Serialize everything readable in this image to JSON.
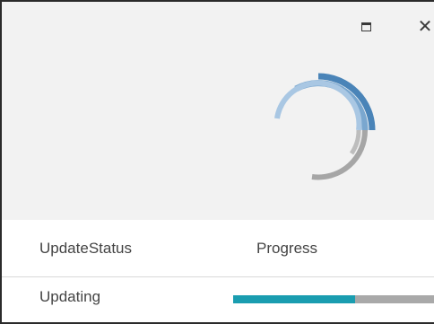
{
  "window": {
    "maximize_icon": "maximize-icon",
    "close_icon": "close-icon",
    "close_glyph": "✕"
  },
  "spinner": {
    "icon": "loading-spinner-icon",
    "colors": {
      "dark_blue": "#4a84b8",
      "mid_blue": "#7aa7cf",
      "light_blue": "#a9c7e3",
      "gray": "#a6a6a6"
    }
  },
  "table": {
    "columns": [
      "UpdateStatus",
      "Progress"
    ],
    "rows": [
      {
        "status": "Updating",
        "progress": 0.6
      }
    ]
  },
  "colors": {
    "progress_fill": "#1a9db0",
    "progress_track": "#a9a9a9"
  }
}
